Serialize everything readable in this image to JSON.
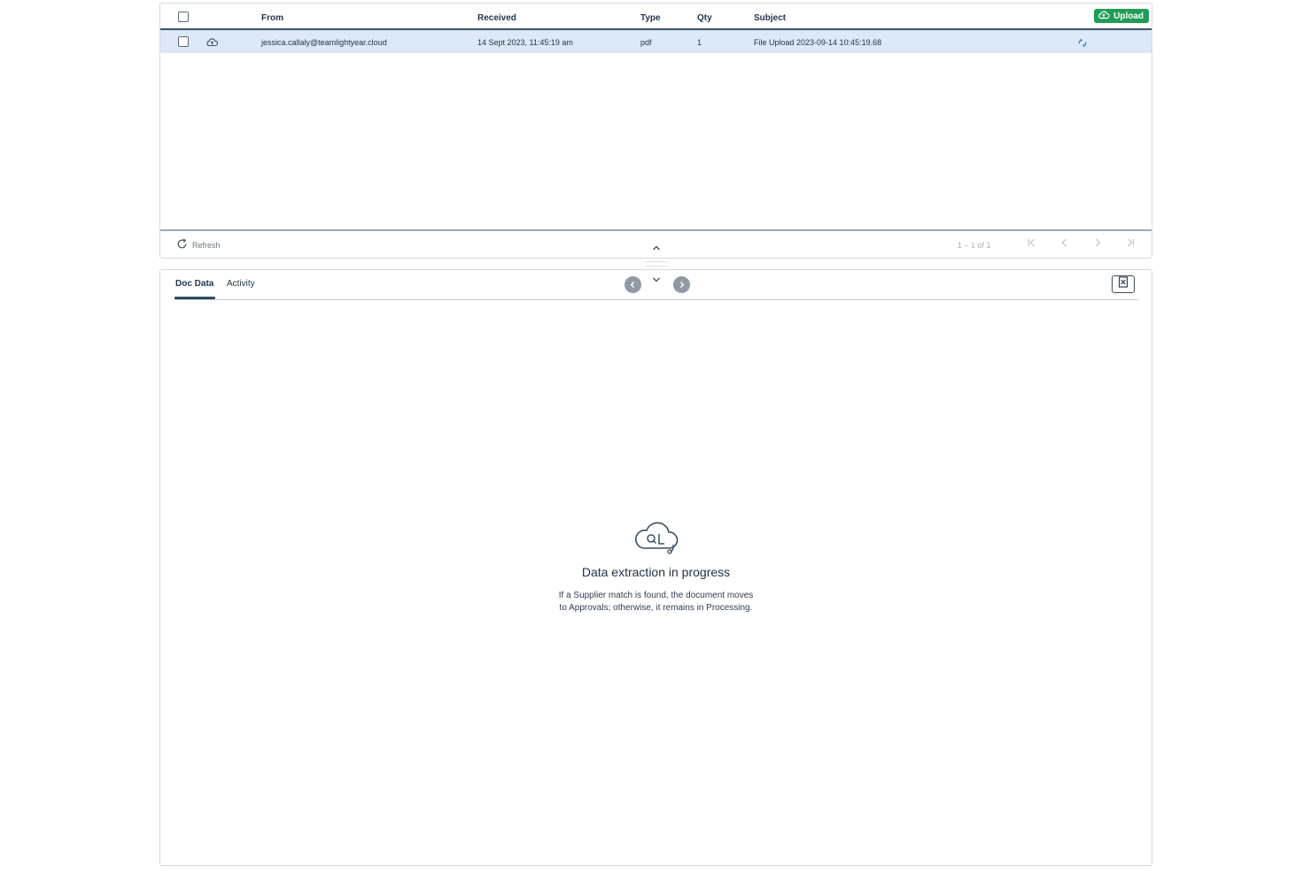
{
  "grid": {
    "columns": {
      "from": "From",
      "received": "Received",
      "type": "Type",
      "qty": "Qty",
      "subject": "Subject"
    },
    "upload_label": "Upload",
    "rows": [
      {
        "from": "jessica.callaly@teamlightyear.cloud",
        "received": "14 Sept 2023, 11:45:19 am",
        "type": "pdf",
        "qty": "1",
        "subject": "File Upload 2023-09-14 10:45:19.68"
      }
    ],
    "footer": {
      "refresh_label": "Refresh",
      "pagination": "1 – 1 of 1"
    }
  },
  "detail": {
    "tabs": [
      "Doc Data",
      "Activity"
    ],
    "empty_state": {
      "title": "Data extraction in progress",
      "description_line1": "If a Supplier match is found, the document moves",
      "description_line2": "to Approvals; otherwise, it remains in Processing."
    }
  },
  "colors": {
    "upload_green": "#1f9d57",
    "selected_row": "#dde8f8",
    "header_rule": "#3a5266",
    "sync_blue": "#3a7be0"
  },
  "icons": {
    "upload": "cloud-upload-icon",
    "row_source": "cloud-upload-icon",
    "row_status": "sync-icon",
    "refresh": "refresh-icon",
    "empty_state": "cloud-search-icon",
    "close": "close-icon"
  }
}
